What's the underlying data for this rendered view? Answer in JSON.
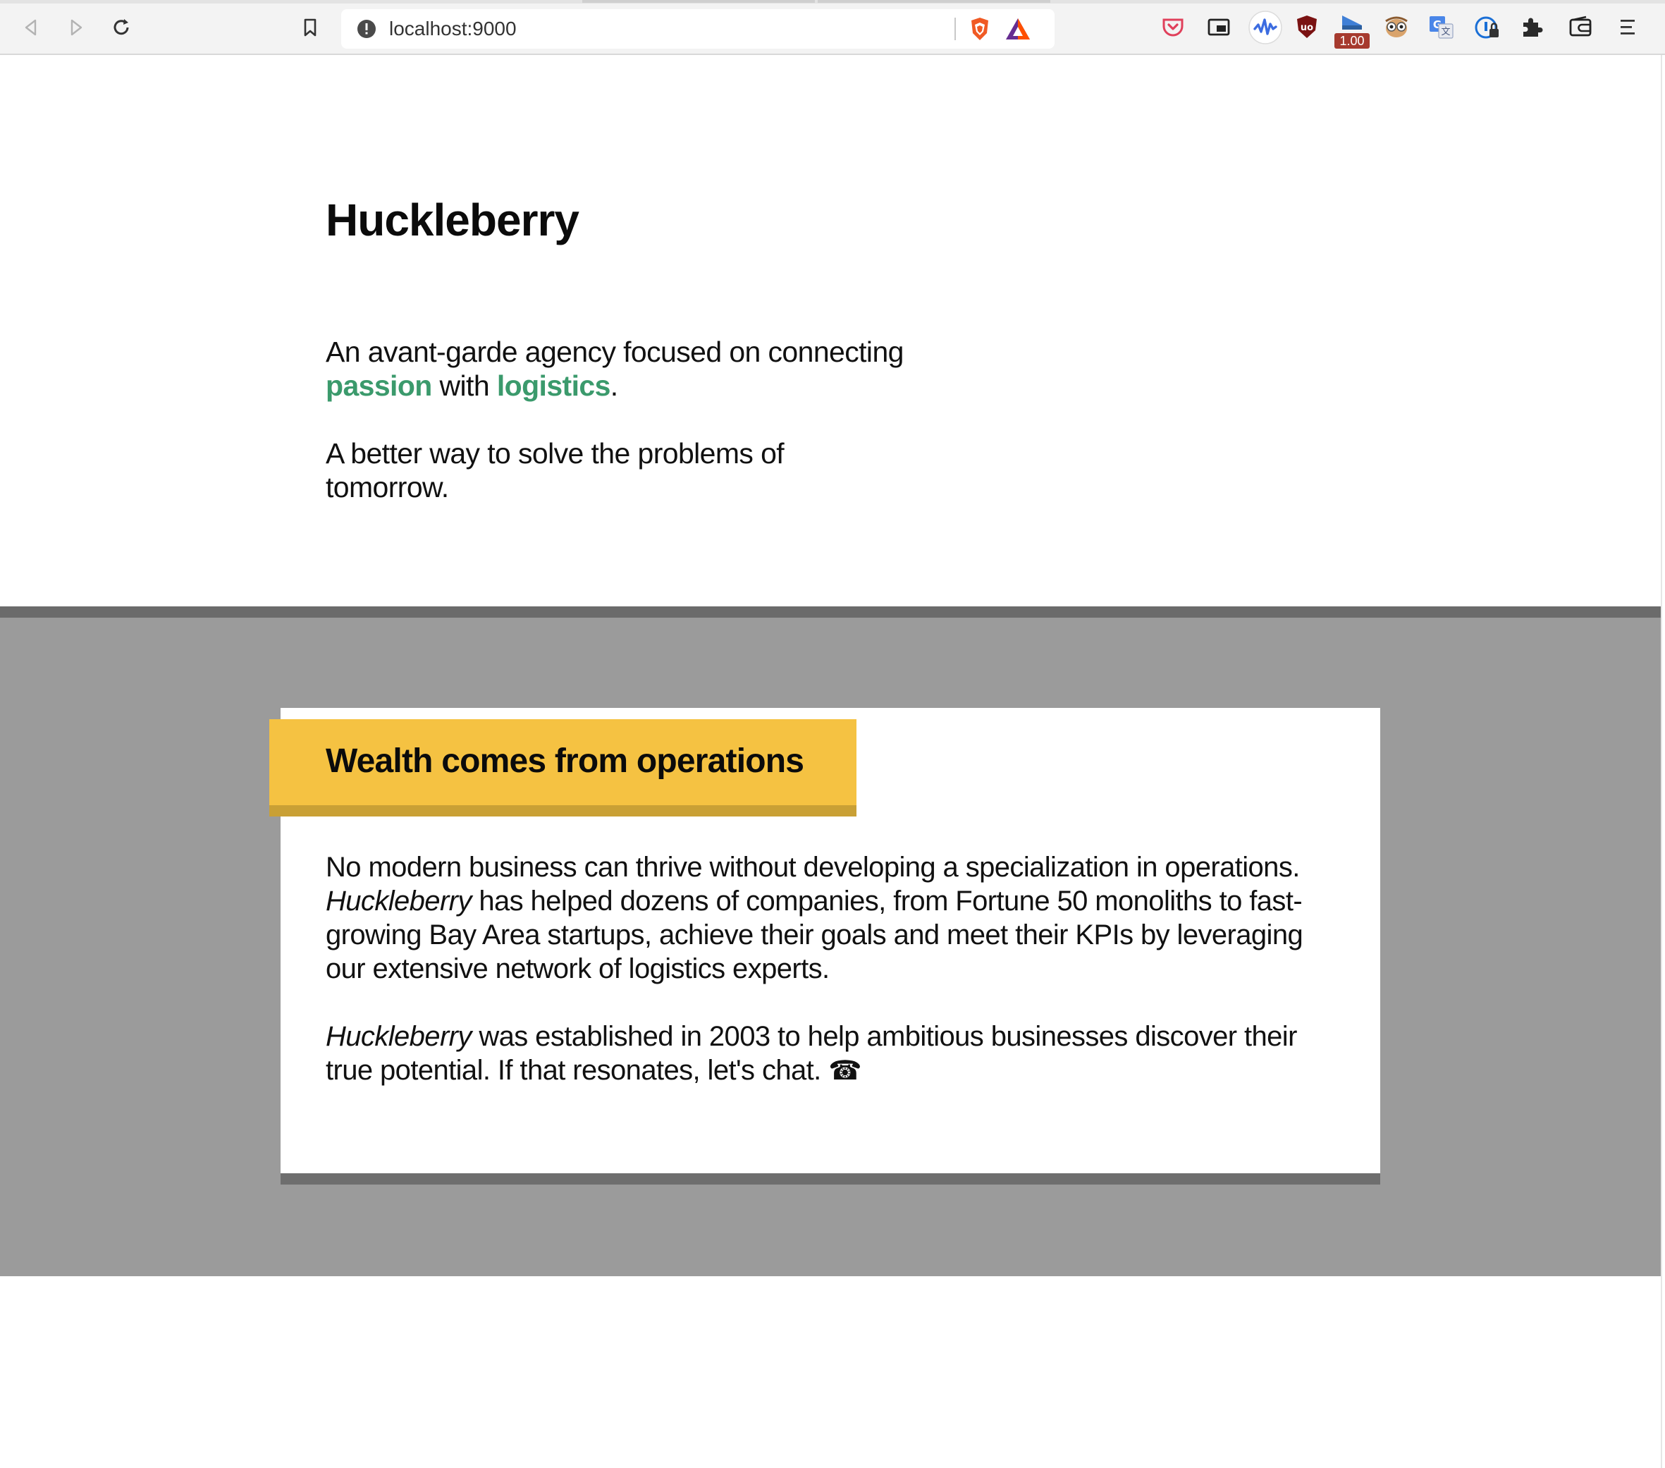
{
  "browser": {
    "url": "localhost:9000",
    "extension_badge": "1.00",
    "icons": [
      "back-icon",
      "forward-icon",
      "reload-icon",
      "bookmark-icon",
      "site-info-icon",
      "brave-shields-icon",
      "bat-rewards-icon",
      "pocket-icon",
      "picture-in-picture-icon",
      "audio-wave-icon",
      "ublock-icon",
      "playback-speed-icon",
      "owl-extension-icon",
      "translate-icon",
      "password-manager-icon",
      "extensions-puzzle-icon",
      "wallet-icon",
      "menu-icon"
    ]
  },
  "hero": {
    "title": "Huckleberry",
    "tagline_prefix": "An avant-garde agency focused on connecting",
    "tagline_accent1": "passion",
    "tagline_middle": "with",
    "tagline_accent2": "logistics",
    "tagline_suffix": ".",
    "subtitle": "A better way to solve the problems of tomorrow."
  },
  "card": {
    "heading": "Wealth comes from operations",
    "para1_brand": "Huckleberry",
    "para1_lead": "No modern business can thrive without developing a specialization in operations.",
    "para1_rest": "has helped dozens of companies, from Fortune 50 monoliths to fast-growing Bay Area startups, achieve their goals and meet their KPIs by leveraging our extensive network of logistics experts.",
    "para2_brand": "Huckleberry",
    "para2_rest": "was established in 2003 to help ambitious businesses discover their true potential. If that resonates, let's chat.",
    "phone_glyph": "☎"
  },
  "colors": {
    "accent_green": "#3b9a6c",
    "heading_yellow": "#f5c242",
    "band_gray": "#9b9b9b"
  }
}
